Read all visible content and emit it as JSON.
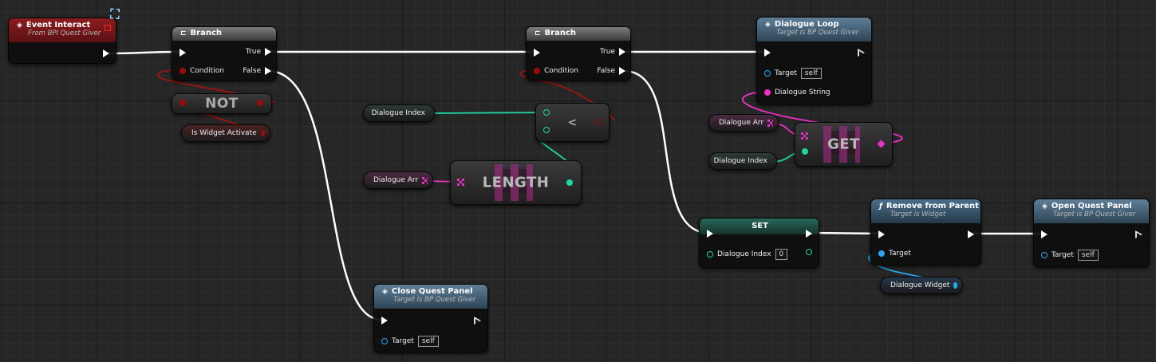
{
  "colors": {
    "exec": "#ffffff",
    "bool": "#9a0c0c",
    "int": "#1ed8a6",
    "object": "#27a7f2",
    "string": "#f231c8",
    "event_header": "#8c1d20",
    "function_header": "#4c6f8b"
  },
  "icons": {
    "event": "diamond-icon",
    "branch": "branch-icon",
    "function": "function-icon",
    "corner": "collapse-icon"
  },
  "event_interact": {
    "title": "Event Interact",
    "subtitle": "From BPI Quest Giver"
  },
  "branch1": {
    "title": "Branch",
    "condition": "Condition",
    "true_label": "True",
    "false_label": "False"
  },
  "not_node": {
    "label": "NOT"
  },
  "is_widget_activate": {
    "label": "Is Widget Activate"
  },
  "close_quest_panel": {
    "title": "Close Quest Panel",
    "subtitle": "Target is BP Quest Giver",
    "target_label": "Target",
    "target_value": "self"
  },
  "dialogue_index_var1": {
    "label": "Dialogue Index"
  },
  "less_than": {
    "label": "<"
  },
  "dialogue_arr_var1": {
    "label": "Dialogue Arr"
  },
  "length_node": {
    "label": "LENGTH"
  },
  "branch2": {
    "title": "Branch",
    "condition": "Condition",
    "true_label": "True",
    "false_label": "False"
  },
  "dialogue_loop": {
    "title": "Dialogue Loop",
    "subtitle": "Target is BP Quest Giver",
    "target_label": "Target",
    "target_value": "self",
    "string_label": "Dialogue String"
  },
  "dialogue_arr_var2": {
    "label": "Dialogue Arr"
  },
  "dialogue_index_var2": {
    "label": "Dialogue Index"
  },
  "get_node": {
    "label": "GET"
  },
  "set_node": {
    "title": "SET",
    "pin_label": "Dialogue Index",
    "pin_value": "0"
  },
  "remove_from_parent": {
    "title": "Remove from Parent",
    "subtitle": "Target is Widget",
    "target_label": "Target"
  },
  "dialogue_widget_var": {
    "label": "Dialogue Widget"
  },
  "open_quest_panel": {
    "title": "Open Quest Panel",
    "subtitle": "Target is BP Quest Giver",
    "target_label": "Target",
    "target_value": "self"
  }
}
